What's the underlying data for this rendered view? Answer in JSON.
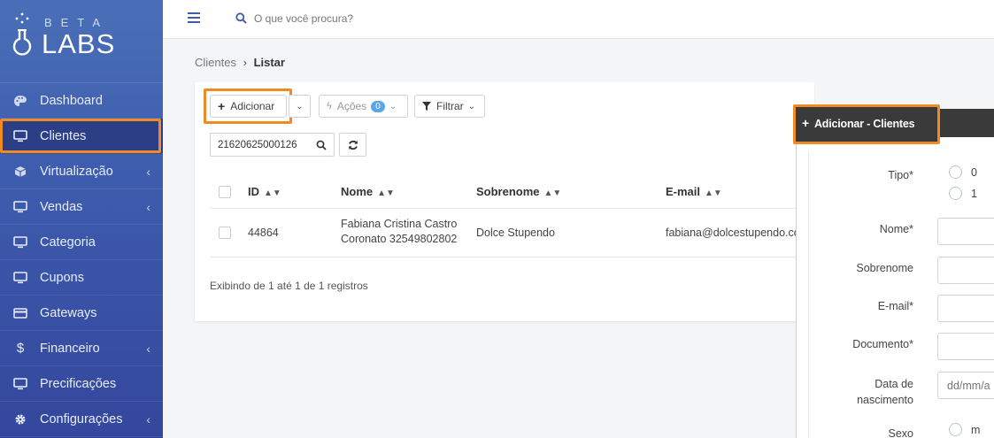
{
  "logo": {
    "beta": "BETA",
    "labs": "LABS"
  },
  "sidebar": {
    "items": [
      {
        "label": "Dashboard"
      },
      {
        "label": "Clientes"
      },
      {
        "label": "Virtualização",
        "chevron": "‹"
      },
      {
        "label": "Vendas",
        "chevron": "‹"
      },
      {
        "label": "Categoria"
      },
      {
        "label": "Cupons"
      },
      {
        "label": "Gateways"
      },
      {
        "label": "Financeiro",
        "chevron": "‹"
      },
      {
        "label": "Precificações"
      },
      {
        "label": "Configurações",
        "chevron": "‹"
      }
    ]
  },
  "topbar": {
    "search_placeholder": "O que você procura?"
  },
  "breadcrumb": {
    "root": "Clientes",
    "separator": "›",
    "current": "Listar"
  },
  "toolbar": {
    "add_label": "Adicionar",
    "actions_label": "Ações",
    "actions_count": "0",
    "filter_label": "Filtrar",
    "filter_value": "21620625000126"
  },
  "table": {
    "headers": {
      "id": "ID",
      "nome": "Nome",
      "sobrenome": "Sobrenome",
      "email": "E-mail"
    },
    "rows": [
      {
        "id": "44864",
        "nome_line1": "Fabiana Cristina Castro",
        "nome_line2": "Coronato 32549802802",
        "sobrenome": "Dolce Stupendo",
        "email": "fabiana@dolcestupendo.co"
      }
    ],
    "info": "Exibindo de 1 até 1 de 1 registros"
  },
  "panel": {
    "title": "Adicionar - Clientes",
    "fields": {
      "tipo": "Tipo*",
      "tipo_options": [
        "0",
        "1"
      ],
      "nome": "Nome*",
      "sobrenome": "Sobrenome",
      "email": "E-mail*",
      "documento": "Documento*",
      "data_line1": "Data de",
      "data_line2": "nascimento",
      "data_placeholder": "dd/mm/a",
      "sexo": "Sexo",
      "sexo_option": "m"
    }
  },
  "colors": {
    "sidebar": "#3e5cad",
    "highlight": "#f08a24",
    "panel_header": "#3a3a3a"
  }
}
